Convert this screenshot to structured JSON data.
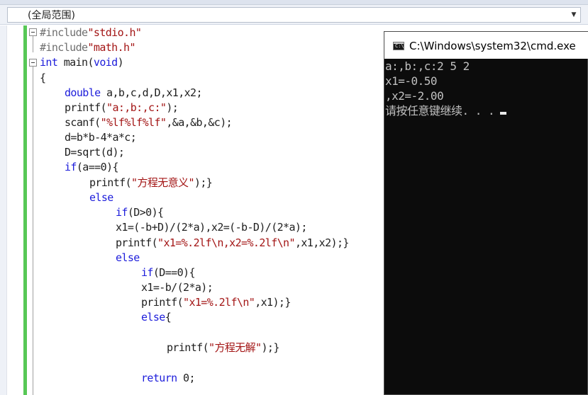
{
  "scope": {
    "label": "(全局范围)"
  },
  "editor": {
    "lines": [
      {
        "parts": [
          {
            "t": "#include",
            "c": "pp"
          },
          {
            "t": "\"stdio.h\"",
            "c": "str"
          }
        ]
      },
      {
        "parts": [
          {
            "t": "#include",
            "c": "pp"
          },
          {
            "t": "\"math.h\"",
            "c": "str"
          }
        ]
      },
      {
        "parts": [
          {
            "t": "int",
            "c": "kw"
          },
          {
            "t": " main(",
            "c": ""
          },
          {
            "t": "void",
            "c": "kw"
          },
          {
            "t": ")",
            "c": ""
          }
        ]
      },
      {
        "parts": [
          {
            "t": "{",
            "c": ""
          }
        ]
      },
      {
        "parts": [
          {
            "t": "double",
            "c": "kw"
          },
          {
            "t": " a,b,c,d,D,x1,x2;",
            "c": ""
          }
        ]
      },
      {
        "parts": [
          {
            "t": "printf(",
            "c": ""
          },
          {
            "t": "\"a:,b:,c:\"",
            "c": "str"
          },
          {
            "t": ");",
            "c": ""
          }
        ]
      },
      {
        "parts": [
          {
            "t": "scanf(",
            "c": ""
          },
          {
            "t": "\"%lf%lf%lf\"",
            "c": "str"
          },
          {
            "t": ",&a,&b,&c);",
            "c": ""
          }
        ]
      },
      {
        "parts": [
          {
            "t": "d=b*b-4*a*c;",
            "c": ""
          }
        ]
      },
      {
        "parts": [
          {
            "t": "D=sqrt(d);",
            "c": ""
          }
        ]
      },
      {
        "parts": [
          {
            "t": "if",
            "c": "kw"
          },
          {
            "t": "(a==0){",
            "c": ""
          }
        ]
      },
      {
        "parts": [
          {
            "t": "printf(",
            "c": ""
          },
          {
            "t": "\"方程无意义\"",
            "c": "str"
          },
          {
            "t": ");}",
            "c": ""
          }
        ]
      },
      {
        "parts": [
          {
            "t": "else",
            "c": "kw"
          }
        ]
      },
      {
        "parts": [
          {
            "t": "if",
            "c": "kw"
          },
          {
            "t": "(D>0){",
            "c": ""
          }
        ]
      },
      {
        "parts": [
          {
            "t": "x1=(-b+D)/(2*a),x2=(-b-D)/(2*a);",
            "c": ""
          }
        ]
      },
      {
        "parts": [
          {
            "t": "printf(",
            "c": ""
          },
          {
            "t": "\"x1=%.2lf\\n,x2=%.2lf\\n\"",
            "c": "str"
          },
          {
            "t": ",x1,x2);}",
            "c": ""
          }
        ]
      },
      {
        "parts": [
          {
            "t": "else",
            "c": "kw"
          }
        ]
      },
      {
        "parts": [
          {
            "t": "if",
            "c": "kw"
          },
          {
            "t": "(D==0){",
            "c": ""
          }
        ]
      },
      {
        "parts": [
          {
            "t": "x1=-b/(2*a);",
            "c": ""
          }
        ]
      },
      {
        "parts": [
          {
            "t": "printf(",
            "c": ""
          },
          {
            "t": "\"x1=%.2lf\\n\"",
            "c": "str"
          },
          {
            "t": ",x1);}",
            "c": ""
          }
        ]
      },
      {
        "parts": [
          {
            "t": "else",
            "c": "kw"
          },
          {
            "t": "{",
            "c": ""
          }
        ]
      },
      {
        "parts": []
      },
      {
        "parts": [
          {
            "t": "printf(",
            "c": ""
          },
          {
            "t": "\"方程无解\"",
            "c": "str"
          },
          {
            "t": ");}",
            "c": ""
          }
        ]
      },
      {
        "parts": []
      },
      {
        "parts": [
          {
            "t": "return",
            "c": "kw"
          },
          {
            "t": " 0;",
            "c": ""
          }
        ]
      }
    ]
  },
  "console": {
    "title": "C:\\Windows\\system32\\cmd.exe",
    "icon": "cmd-window-icon",
    "icon_glyph": "C:\\",
    "lines": [
      "a:,b:,c:2 5 2",
      "x1=-0.50",
      ",x2=-2.00",
      "请按任意键继续. . ."
    ]
  },
  "colors": {
    "keyword": "#1d1ddb",
    "string": "#a31515",
    "preprocessor": "#6f6f6f",
    "change_bar": "#57c856",
    "console_bg": "#0c0c0c",
    "console_text": "#c0c0c0"
  }
}
